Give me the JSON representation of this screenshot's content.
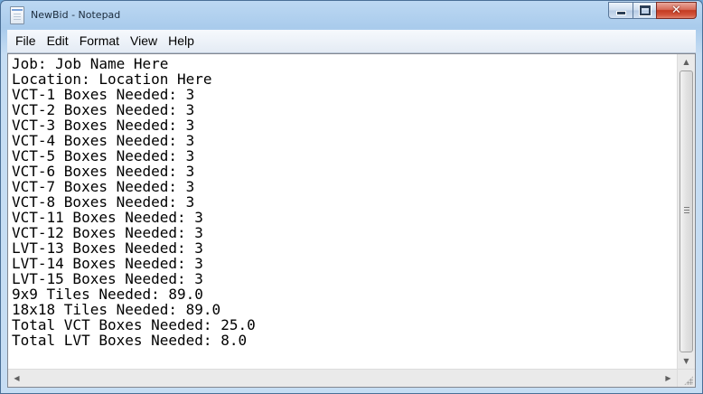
{
  "window": {
    "title": "NewBid - Notepad",
    "icon": "notepad-icon"
  },
  "caption": {
    "minimize_icon": "minimize-icon",
    "maximize_icon": "maximize-icon",
    "close_glyph": "✕"
  },
  "menu": {
    "items": [
      "File",
      "Edit",
      "Format",
      "View",
      "Help"
    ]
  },
  "document": {
    "lines": [
      "Job: Job Name Here",
      "Location: Location Here",
      "VCT-1 Boxes Needed: 3",
      "VCT-2 Boxes Needed: 3",
      "VCT-3 Boxes Needed: 3",
      "VCT-4 Boxes Needed: 3",
      "VCT-5 Boxes Needed: 3",
      "VCT-6 Boxes Needed: 3",
      "VCT-7 Boxes Needed: 3",
      "VCT-8 Boxes Needed: 3",
      "VCT-11 Boxes Needed: 3",
      "VCT-12 Boxes Needed: 3",
      "LVT-13 Boxes Needed: 3",
      "LVT-14 Boxes Needed: 3",
      "LVT-15 Boxes Needed: 3",
      "9x9 Tiles Needed: 89.0",
      "18x18 Tiles Needed: 89.0",
      "Total VCT Boxes Needed: 25.0",
      "Total LVT Boxes Needed: 8.0"
    ]
  },
  "scrollbars": {
    "up_arrow": "▲",
    "down_arrow": "▼",
    "left_arrow": "◀",
    "right_arrow": "▶"
  }
}
